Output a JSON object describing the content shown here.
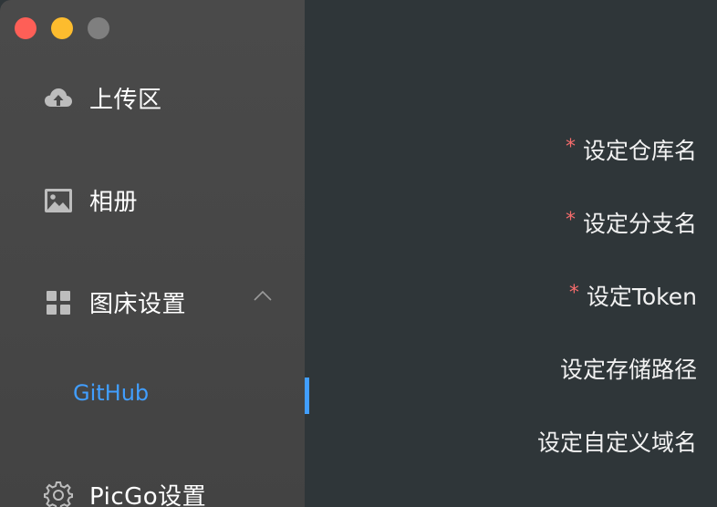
{
  "window": {
    "controls": [
      "close",
      "minimize",
      "maximize"
    ]
  },
  "sidebar": {
    "items": [
      {
        "label": "上传区",
        "icon": "cloud-upload-icon"
      },
      {
        "label": "相册",
        "icon": "image-icon"
      },
      {
        "label": "图床设置",
        "icon": "grid-icon",
        "expanded": true
      },
      {
        "label": "PicGo设置",
        "icon": "gear-icon"
      }
    ],
    "sub_items": [
      {
        "label": "GitHub",
        "selected": true
      }
    ]
  },
  "form": {
    "required_marker": "*",
    "fields": [
      {
        "label": "设定仓库名",
        "required": true
      },
      {
        "label": "设定分支名",
        "required": true
      },
      {
        "label": "设定Token",
        "required": true
      },
      {
        "label": "设定存储路径",
        "required": false
      },
      {
        "label": "设定自定义域名",
        "required": false
      }
    ]
  },
  "colors": {
    "accent": "#419eff",
    "required": "#f56c6c",
    "sidebar_bg": "#474747",
    "main_bg": "#2f3639"
  }
}
